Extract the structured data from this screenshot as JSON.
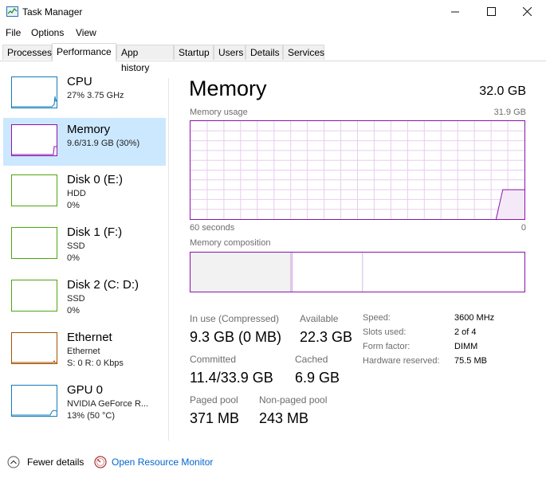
{
  "window": {
    "title": "Task Manager",
    "controls": {
      "minimize": "minimize",
      "maximize": "maximize",
      "close": "close"
    }
  },
  "menu": {
    "items": [
      "File",
      "Options",
      "View"
    ]
  },
  "tabs": {
    "items": [
      "Processes",
      "Performance",
      "App history",
      "Startup",
      "Users",
      "Details",
      "Services"
    ],
    "active": "Performance"
  },
  "sidebar": {
    "items": [
      {
        "name": "CPU",
        "line1": "27%  3.75 GHz",
        "line2": "",
        "color": "#117dbb"
      },
      {
        "name": "Memory",
        "line1": "9.6/31.9 GB (30%)",
        "line2": "",
        "color": "#8b12ae"
      },
      {
        "name": "Disk 0 (E:)",
        "line1": "HDD",
        "line2": "0%",
        "color": "#4da60c"
      },
      {
        "name": "Disk 1 (F:)",
        "line1": "SSD",
        "line2": "0%",
        "color": "#4da60c"
      },
      {
        "name": "Disk 2 (C: D:)",
        "line1": "SSD",
        "line2": "0%",
        "color": "#4da60c"
      },
      {
        "name": "Ethernet",
        "line1": "Ethernet",
        "line2": "S: 0 R: 0 Kbps",
        "color": "#a74f01"
      },
      {
        "name": "GPU 0",
        "line1": "NVIDIA GeForce R...",
        "line2": "13%  (50 °C)",
        "color": "#117dbb"
      }
    ],
    "selected": "Memory"
  },
  "main": {
    "title": "Memory",
    "total": "32.0 GB",
    "usage_label": "Memory usage",
    "usage_max": "31.9 GB",
    "time_left": "60 seconds",
    "time_right": "0",
    "composition_label": "Memory composition",
    "stats": {
      "in_use_label": "In use (Compressed)",
      "in_use_value": "9.3 GB (0 MB)",
      "available_label": "Available",
      "available_value": "22.3 GB",
      "committed_label": "Committed",
      "committed_value": "11.4/33.9 GB",
      "cached_label": "Cached",
      "cached_value": "6.9 GB",
      "paged_label": "Paged pool",
      "paged_value": "371 MB",
      "nonpaged_label": "Non-paged pool",
      "nonpaged_value": "243 MB"
    },
    "details": [
      {
        "label": "Speed:",
        "value": "3600 MHz"
      },
      {
        "label": "Slots used:",
        "value": "2 of 4"
      },
      {
        "label": "Form factor:",
        "value": "DIMM"
      },
      {
        "label": "Hardware reserved:",
        "value": "75.5 MB"
      }
    ],
    "usage_fraction": 0.3,
    "composition": {
      "in_use_fraction": 0.3,
      "modified_fraction": 0.005,
      "standby_fraction": 0.21
    }
  },
  "footer": {
    "fewer_details": "Fewer details",
    "resource_monitor": "Open Resource Monitor"
  },
  "colors": {
    "memory_accent": "#8b12ae",
    "grid": "#e7cdee",
    "fill": "#f4eaf7",
    "selection": "#cce8ff"
  }
}
